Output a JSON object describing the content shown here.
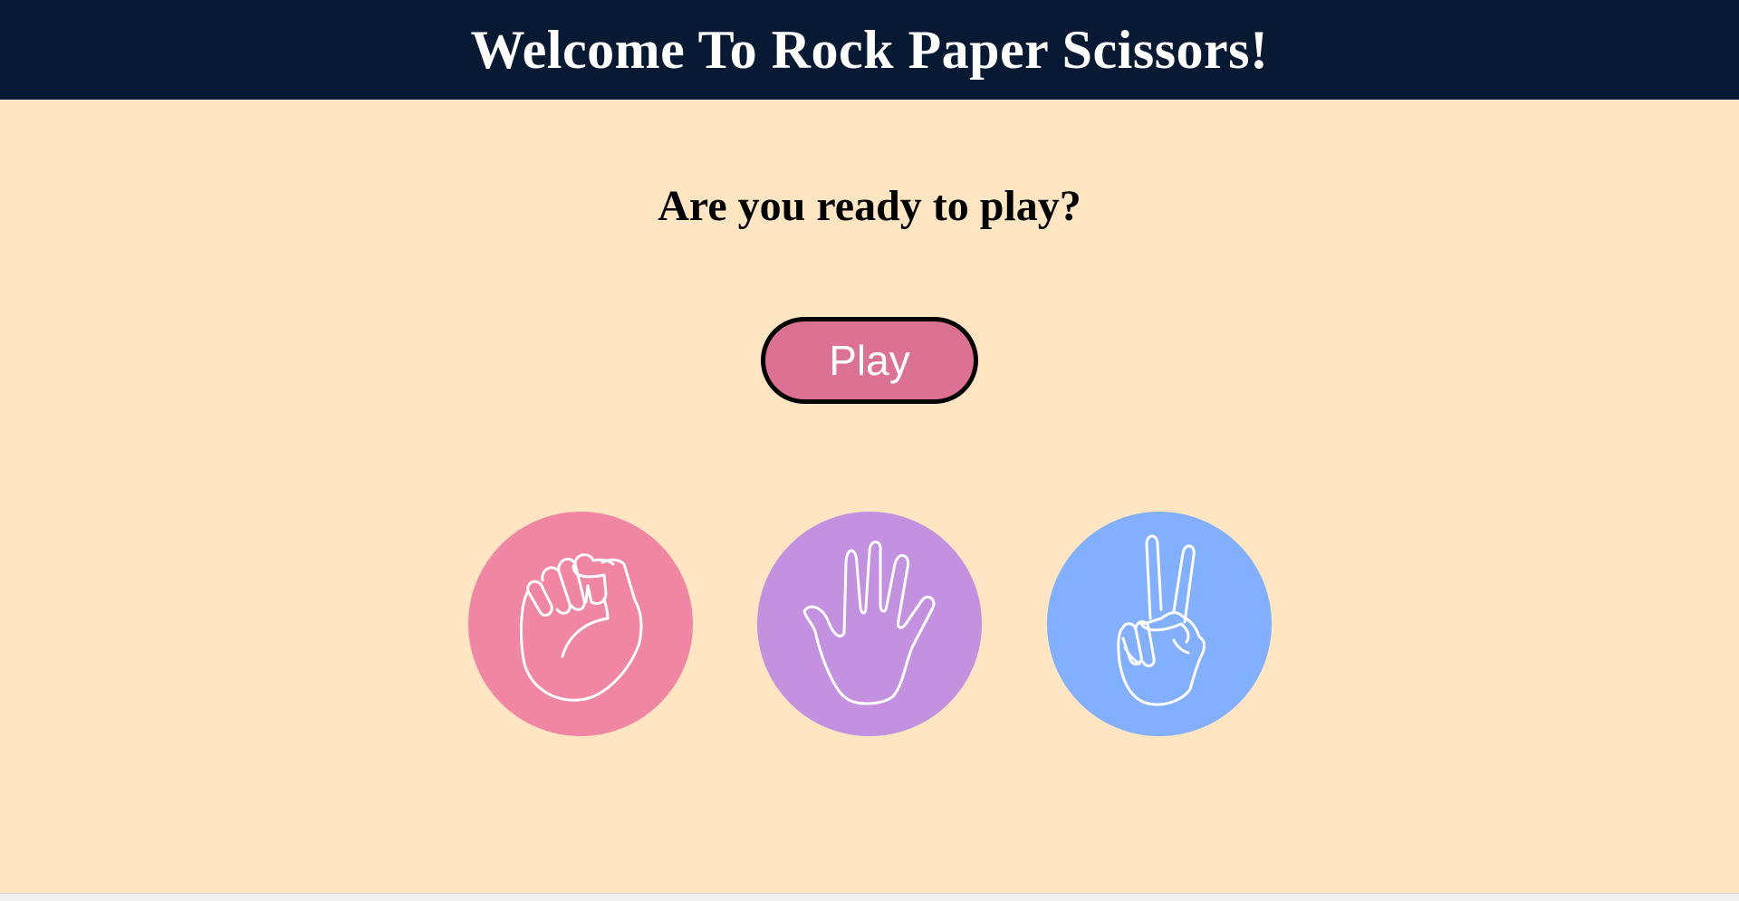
{
  "header": {
    "title": "Welcome To Rock Paper Scissors!"
  },
  "main": {
    "prompt": "Are you ready to play?",
    "play_label": "Play"
  },
  "choices": [
    {
      "name": "rock",
      "icon": "fist-icon",
      "color": "#F086A3"
    },
    {
      "name": "paper",
      "icon": "open-hand-icon",
      "color": "#C391DF"
    },
    {
      "name": "scissors",
      "icon": "peace-hand-icon",
      "color": "#82AFFF"
    }
  ],
  "colors": {
    "header_bg": "#081A33",
    "page_bg": "#FFE5C2",
    "play_button": "#DC7193"
  }
}
